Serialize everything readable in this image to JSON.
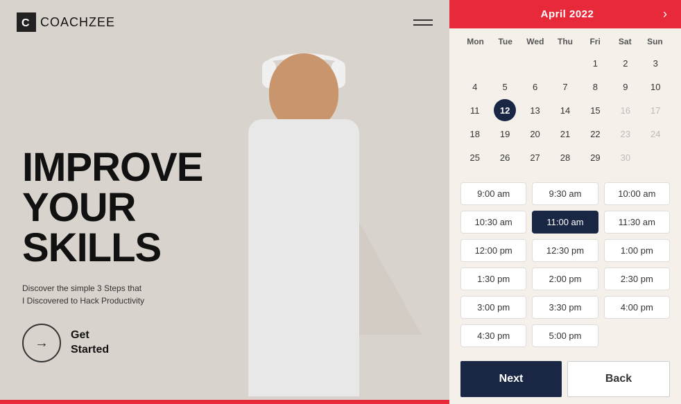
{
  "app": {
    "logo_icon": "C",
    "logo_name": "COACH",
    "logo_name2": "ZEE"
  },
  "left": {
    "headline_line1": "IMPROVE",
    "headline_line2": "YOUR",
    "headline_line3": "SKILLS",
    "subtitle_line1": "Discover the simple 3 Steps that",
    "subtitle_line2": "I Discovered to Hack Productivity",
    "cta_label_line1": "Get",
    "cta_label_line2": "Started"
  },
  "calendar": {
    "month": "April  2022",
    "weekdays": [
      "Mon",
      "Tue",
      "Wed",
      "Thu",
      "Fri",
      "Sat",
      "Sun"
    ],
    "weeks": [
      [
        "",
        "",
        "",
        "",
        "1",
        "2",
        "3"
      ],
      [
        "4",
        "5",
        "6",
        "7",
        "8",
        "9",
        "10"
      ],
      [
        "11",
        "12",
        "13",
        "14",
        "15",
        "16",
        "17"
      ],
      [
        "18",
        "19",
        "20",
        "21",
        "22",
        "23",
        "24"
      ],
      [
        "25",
        "26",
        "27",
        "28",
        "29",
        "30",
        ""
      ]
    ],
    "today": "12",
    "muted_days": [
      "23",
      "24",
      "30"
    ]
  },
  "time_slots": [
    {
      "label": "9:00 am",
      "selected": false
    },
    {
      "label": "9:30 am",
      "selected": false
    },
    {
      "label": "10:00 am",
      "selected": false
    },
    {
      "label": "10:30 am",
      "selected": false
    },
    {
      "label": "11:00 am",
      "selected": true
    },
    {
      "label": "11:30 am",
      "selected": false
    },
    {
      "label": "12:00 pm",
      "selected": false
    },
    {
      "label": "12:30 pm",
      "selected": false
    },
    {
      "label": "1:00 pm",
      "selected": false
    },
    {
      "label": "1:30 pm",
      "selected": false
    },
    {
      "label": "2:00 pm",
      "selected": false
    },
    {
      "label": "2:30 pm",
      "selected": false
    },
    {
      "label": "3:00 pm",
      "selected": false
    },
    {
      "label": "3:30 pm",
      "selected": false
    },
    {
      "label": "4:00 pm",
      "selected": false
    },
    {
      "label": "4:30 pm",
      "selected": false
    },
    {
      "label": "5:00 pm",
      "selected": false
    }
  ],
  "buttons": {
    "next": "Next",
    "back": "Back"
  }
}
